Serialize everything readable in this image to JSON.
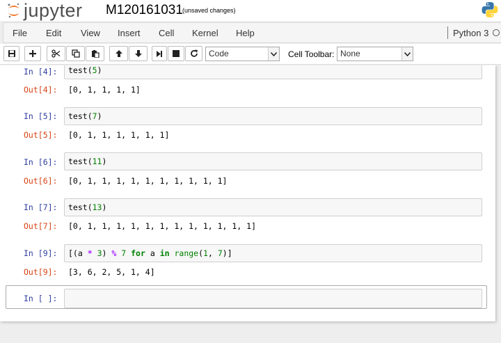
{
  "header": {
    "logo_text": "jupyter",
    "notebook_name": "M120161031",
    "save_status": "(unsaved changes)"
  },
  "menubar": {
    "items": [
      "File",
      "Edit",
      "View",
      "Insert",
      "Cell",
      "Kernel",
      "Help"
    ],
    "kernel_name": "Python 3"
  },
  "toolbar": {
    "cell_type": "Code",
    "cell_toolbar_label": "Cell Toolbar:",
    "cell_toolbar_value": "None"
  },
  "cells": [
    {
      "in_prompt": "In [4]:",
      "code": "test(5)",
      "out_prompt": "Out[4]:",
      "output": "[0, 1, 1, 1, 1]"
    },
    {
      "in_prompt": "In [5]:",
      "code": "test(7)",
      "out_prompt": "Out[5]:",
      "output": "[0, 1, 1, 1, 1, 1, 1]"
    },
    {
      "in_prompt": "In [6]:",
      "code": "test(11)",
      "out_prompt": "Out[6]:",
      "output": "[0, 1, 1, 1, 1, 1, 1, 1, 1, 1, 1]"
    },
    {
      "in_prompt": "In [7]:",
      "code": "test(13)",
      "out_prompt": "Out[7]:",
      "output": "[0, 1, 1, 1, 1, 1, 1, 1, 1, 1, 1, 1, 1]"
    },
    {
      "in_prompt": "In [9]:",
      "code": "[(a * 3) % 7 for a in range(1, 7)]",
      "out_prompt": "Out[9]:",
      "output": "[3, 6, 2, 5, 1, 4]"
    }
  ],
  "empty_cell": {
    "in_prompt": "In [ ]:"
  },
  "colors": {
    "in_prompt": "#303f9f",
    "out_prompt": "#d84315",
    "keyword": "#008000",
    "operator": "#aa22ff",
    "logo_orange": "#f37726"
  }
}
